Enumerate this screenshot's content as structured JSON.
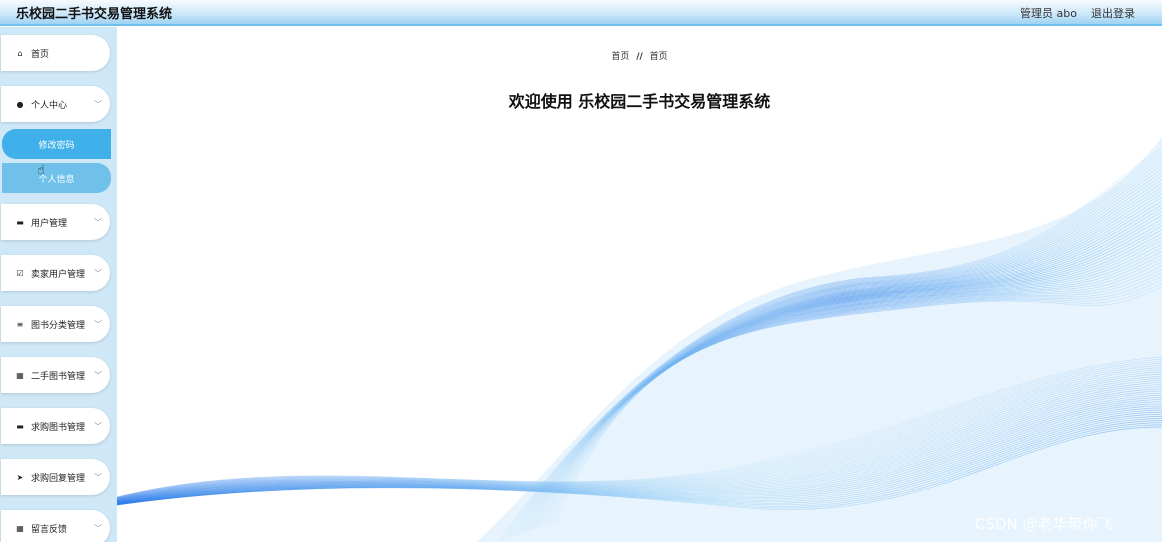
{
  "header": {
    "title": "乐校园二手书交易管理系统",
    "admin_label": "管理员 abo",
    "logout_label": "退出登录"
  },
  "sidebar": {
    "items": [
      {
        "label": "首页",
        "icon": "home-icon"
      },
      {
        "label": "个人中心",
        "icon": "user-icon"
      },
      {
        "label": "用户管理",
        "icon": "monitor-icon"
      },
      {
        "label": "卖家用户管理",
        "icon": "checkbox-icon"
      },
      {
        "label": "图书分类管理",
        "icon": "list-icon"
      },
      {
        "label": "二手图书管理",
        "icon": "grid-icon"
      },
      {
        "label": "求购图书管理",
        "icon": "chat-icon"
      },
      {
        "label": "求购回复管理",
        "icon": "send-icon"
      },
      {
        "label": "留言反馈",
        "icon": "grid-icon"
      }
    ],
    "subitems": [
      {
        "label": "修改密码"
      },
      {
        "label": "个人信息"
      }
    ]
  },
  "main": {
    "breadcrumb": [
      "首页",
      "//",
      "首页"
    ],
    "welcome": "欢迎使用 乐校园二手书交易管理系统"
  },
  "watermark": "CSDN @老华带你飞",
  "colors": {
    "accent": "#3fb0ea",
    "sidebar_bg": "#cfe8f7",
    "wave_dark": "#1e73e8",
    "wave_light": "#7cc4f4"
  }
}
